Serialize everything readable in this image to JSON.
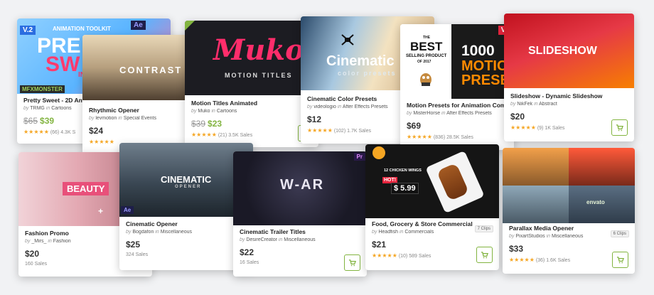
{
  "colors": {
    "accent": "#82b440",
    "star": "#f5a623"
  },
  "cards": [
    {
      "title": "Pretty Sweet - 2D An",
      "author": "TRMG",
      "category": "Cartoons",
      "old_price": "$65",
      "price": "$39",
      "reviews": "(66)",
      "sales": "4.3K S",
      "thumb": {
        "headline1": "PRE",
        "headline2": "SW",
        "headline3": "INCR",
        "tag": "ANIMATION TOOLKIT",
        "v": "V.2",
        "ae": "Ae",
        "brand": "MFXMONSTER"
      }
    },
    {
      "title": "Rhythmic Opener",
      "author": "levmotion",
      "category": "Special Events",
      "price": "$24",
      "thumb": {
        "headline": "CONTRAST"
      }
    },
    {
      "title": "Motion Titles Animated",
      "author": "Muko",
      "category": "Cartoons",
      "old_price": "$39",
      "price": "$23",
      "reviews": "(21)",
      "sales": "3.5K Sales",
      "thumb": {
        "headline": "Muko",
        "sub": "MOTION TITLES"
      }
    },
    {
      "title": "Cinematic Color Presets",
      "author": "videologio",
      "category": "After Effects Presets",
      "price": "$12",
      "reviews": "(102)",
      "sales": "1.7K Sales",
      "thumb": {
        "headline": "Cinematic",
        "sub": "color presets"
      }
    },
    {
      "title": "Motion Presets for Animation Com",
      "author": "MisterHorse",
      "category": "After Effects Presets",
      "price": "$69",
      "reviews": "(836)",
      "sales": "28.5K Sales",
      "thumb": {
        "line1": "THE",
        "line2": "BEST",
        "line3": "SELLING PRODUCT",
        "line4": "OF 2017",
        "big1": "1000",
        "big2": "MOTIO",
        "big3": "PRESE",
        "v": "V2"
      }
    },
    {
      "title": "Slideshow - Dynamic Slideshow",
      "author": "NikFek",
      "category": "Abstract",
      "price": "$20",
      "reviews": "(9)",
      "sales": "1K Sales",
      "thumb": {
        "headline": "SLIDESHOW"
      }
    },
    {
      "title": "Fashion Promo",
      "author": "_Mirs_",
      "category": "Fashion",
      "price": "$20",
      "sales": "160 Sales",
      "thumb": {
        "headline": "BEAUTY"
      }
    },
    {
      "title": "Cinematic Opener",
      "author": "Bogdafon",
      "category": "Miscellaneous",
      "price": "$25",
      "sales": "324 Sales",
      "thumb": {
        "headline": "CINEMATIC",
        "sub": "OPENER",
        "ae": "Ae"
      }
    },
    {
      "title": "Cinematic Trailer Titles",
      "author": "DesireCreator",
      "category": "Miscellaneous",
      "price": "$22",
      "sales": "16 Sales",
      "thumb": {
        "headline": "W-AR",
        "pr": "Pr"
      }
    },
    {
      "title": "Food, Grocery & Store Commercial",
      "author": "Headfish",
      "category": "Commercials",
      "clips": "7 Clips",
      "price": "$21",
      "reviews": "(10)",
      "sales": "589 Sales",
      "thumb": {
        "label": "12 CHICKEN WINGS",
        "hot": "HOT!",
        "price": "$ 5.99"
      }
    },
    {
      "title": "Parallax Media Opener",
      "author": "PixartStudios",
      "category": "Miscellaneous",
      "clips": "6 Clips",
      "price": "$33",
      "reviews": "(36)",
      "sales": "1.6K Sales",
      "thumb": {
        "logo": "envato"
      }
    }
  ],
  "labels": {
    "by": "by",
    "in": "in"
  }
}
